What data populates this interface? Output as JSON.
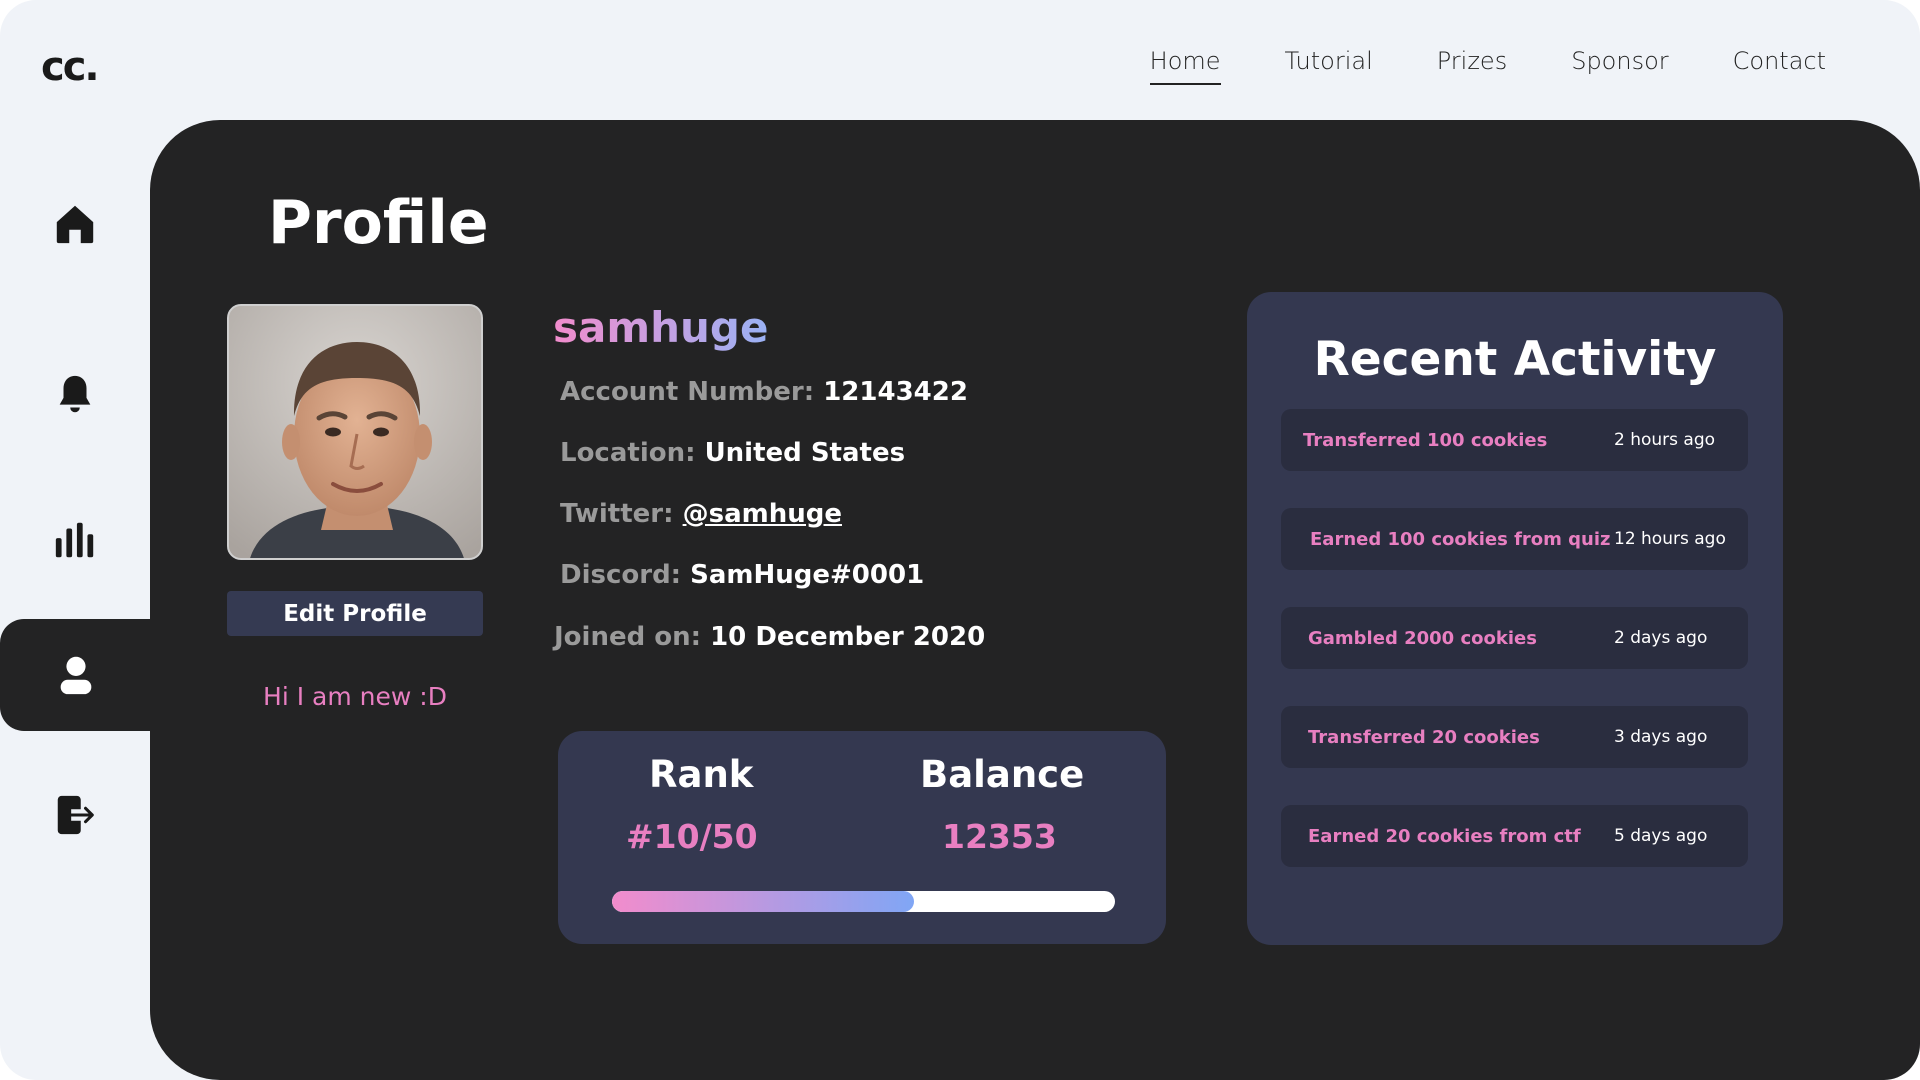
{
  "brand": {
    "logo": "cc."
  },
  "nav": {
    "items": [
      {
        "label": "Home",
        "active": true
      },
      {
        "label": "Tutorial",
        "active": false
      },
      {
        "label": "Prizes",
        "active": false
      },
      {
        "label": "Sponsor",
        "active": false
      },
      {
        "label": "Contact",
        "active": false
      }
    ]
  },
  "sidebar": {
    "items": [
      {
        "icon": "home-icon",
        "active": false
      },
      {
        "icon": "bell-icon",
        "active": false
      },
      {
        "icon": "bar-chart-icon",
        "active": false
      },
      {
        "icon": "user-icon",
        "active": true
      },
      {
        "icon": "logout-icon",
        "active": false
      }
    ]
  },
  "profile": {
    "title": "Profile",
    "username": "samhuge",
    "edit_label": "Edit Profile",
    "bio": "Hi I am new :D",
    "fields": {
      "account_label": "Account Number:",
      "account_value": "12143422",
      "location_label": "Location:",
      "location_value": "United States",
      "twitter_label": "Twitter:",
      "twitter_value": "@samhuge",
      "discord_label": "Discord:",
      "discord_value": "SamHuge#0001",
      "joined_label": "Joined on:",
      "joined_value": "10 December 2020"
    }
  },
  "stats": {
    "rank_label": "Rank",
    "rank_value": "#10/50",
    "balance_label": "Balance",
    "balance_value": "12353",
    "progress_fraction": 0.6
  },
  "activity": {
    "title": "Recent Activity",
    "items": [
      {
        "text": "Transferred 100 cookies",
        "time": "2 hours ago"
      },
      {
        "text": "Earned 100 cookies from quiz",
        "time": "12 hours ago"
      },
      {
        "text": "Gambled 2000 cookies",
        "time": "2 days ago"
      },
      {
        "text": "Transferred 20 cookies",
        "time": "3 days ago"
      },
      {
        "text": "Earned 20 cookies from ctf",
        "time": "5 days ago"
      }
    ]
  },
  "colors": {
    "accent_pink": "#e87fc1",
    "accent_blue": "#80a6f5",
    "panel": "#343850",
    "background_dark": "#232324",
    "background_light": "#f0f3f8"
  }
}
